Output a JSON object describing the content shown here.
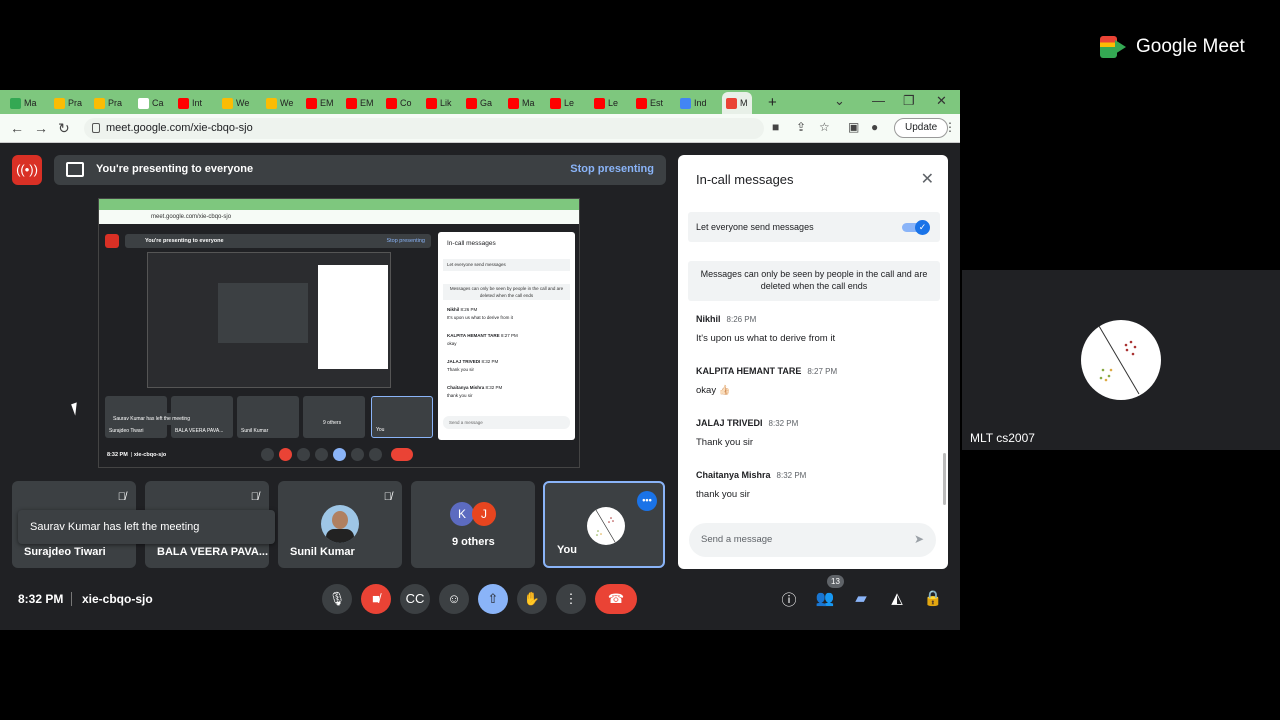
{
  "brand": {
    "name": "Google Meet"
  },
  "side_tile": {
    "name": "MLT cs2007"
  },
  "browser": {
    "tabs": [
      {
        "label": "Ma",
        "color": "#34a853"
      },
      {
        "label": "Pra",
        "color": "#fbbc04"
      },
      {
        "label": "Pra",
        "color": "#fbbc04"
      },
      {
        "label": "Ca",
        "color": "#ffffff"
      },
      {
        "label": "Int",
        "color": "#ff0000"
      },
      {
        "label": "We",
        "color": "#fbbc04"
      },
      {
        "label": "We",
        "color": "#fbbc04"
      },
      {
        "label": "EM",
        "color": "#ff0000"
      },
      {
        "label": "EM",
        "color": "#ff0000"
      },
      {
        "label": "Co",
        "color": "#ff0000"
      },
      {
        "label": "Lik",
        "color": "#ff0000"
      },
      {
        "label": "Ga",
        "color": "#ff0000"
      },
      {
        "label": "Ma",
        "color": "#ff0000"
      },
      {
        "label": "Le",
        "color": "#ff0000"
      },
      {
        "label": "Le",
        "color": "#ff0000"
      },
      {
        "label": "Est",
        "color": "#ff0000"
      },
      {
        "label": "Ind",
        "color": "#4285f4"
      },
      {
        "label": "M",
        "color": "#ea4335"
      }
    ],
    "url": "meet.google.com/xie-cbqo-sjo",
    "update_label": "Update"
  },
  "banner": {
    "text": "You're presenting to everyone",
    "stop_label": "Stop presenting"
  },
  "shared_screen": {
    "url": "meet.google.com/xie-cbqo-sjo",
    "banner_text": "You're presenting to everyone",
    "stop_label": "Stop presenting",
    "chat_title": "In-call messages",
    "toggle_label": "Let everyone send messages",
    "note": "Messages can only be seen by people in the call and are deleted when the call ends",
    "input_placeholder": "Send a message",
    "messages": [
      {
        "sender": "Nikhil",
        "time": "8:26 PM",
        "text": "It's upon us what to derive from it"
      },
      {
        "sender": "KALPITA HEMANT TARE",
        "time": "8:27 PM",
        "text": "okay"
      },
      {
        "sender": "JALAJ TRIVEDI",
        "time": "8:32 PM",
        "text": "Thank you sir"
      },
      {
        "sender": "Chaitanya Mishra",
        "time": "8:32 PM",
        "text": "thank you sir"
      }
    ],
    "tiles": [
      "Surajdeo Tiwari",
      "BALA VEERA PAVA...",
      "Sunil Kumar",
      "9 others",
      "You"
    ],
    "toast": "Saurav Kumar has left the meeting",
    "time": "8:32 PM",
    "code": "xie-cbqo-sjo"
  },
  "participants": [
    {
      "name": "Surajdeo Tiwari",
      "muted": true
    },
    {
      "name": "BALA VEERA PAVA...",
      "muted": true
    },
    {
      "name": "Sunil Kumar",
      "muted": true
    },
    {
      "name": "9 others",
      "avatars": [
        "K",
        "J"
      ]
    },
    {
      "name": "You"
    }
  ],
  "toast": "Saurav Kumar has left the meeting",
  "footer": {
    "time": "8:32 PM",
    "meeting_code": "xie-cbqo-sjo",
    "people_count": "13"
  },
  "chat": {
    "title": "In-call messages",
    "toggle_label": "Let everyone send messages",
    "toggle_on": true,
    "note": "Messages can only be seen by people in the call and are deleted when the call ends",
    "messages": [
      {
        "sender": "Nikhil",
        "time": "8:26 PM",
        "text": "It's upon us what to derive from it"
      },
      {
        "sender": "KALPITA HEMANT TARE",
        "time": "8:27 PM",
        "text": "okay 👍🏻"
      },
      {
        "sender": "JALAJ TRIVEDI",
        "time": "8:32 PM",
        "text": "Thank you sir"
      },
      {
        "sender": "Chaitanya Mishra",
        "time": "8:32 PM",
        "text": "thank you sir"
      }
    ],
    "input_placeholder": "Send a message"
  },
  "colors": {
    "tab_bar": "#7ec77e",
    "meet_bg": "#202124",
    "tile_bg": "#3c4043",
    "accent": "#8ab4f8",
    "danger": "#ea4335"
  }
}
